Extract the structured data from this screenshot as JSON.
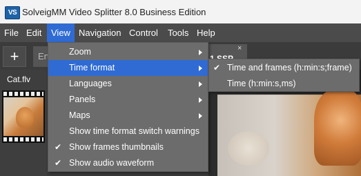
{
  "window": {
    "title": "SolveigMM Video Splitter 8.0 Business Edition",
    "icon_text": "VS"
  },
  "menubar": [
    "File",
    "Edit",
    "View",
    "Navigation",
    "Control",
    "Tools",
    "Help"
  ],
  "toolbar": {
    "add_label": "+",
    "tab_stub": "En",
    "tab_label": "1 SSP",
    "tab_close": "×"
  },
  "file_panel": {
    "file_name": "Cat.flv"
  },
  "view_menu": {
    "items": [
      {
        "label": "Zoom",
        "submenu": true,
        "checked": false
      },
      {
        "label": "Time format",
        "submenu": true,
        "checked": false,
        "highlighted": true
      },
      {
        "label": "Languages",
        "submenu": true,
        "checked": false
      },
      {
        "label": "Panels",
        "submenu": true,
        "checked": false
      },
      {
        "label": "Maps",
        "submenu": true,
        "checked": false
      },
      {
        "label": "Show time format switch warnings",
        "submenu": false,
        "checked": false
      },
      {
        "label": "Show frames thumbnails",
        "submenu": false,
        "checked": true
      },
      {
        "label": "Show audio waveform",
        "submenu": false,
        "checked": true
      }
    ],
    "check_glyph": "✔"
  },
  "time_format_menu": {
    "items": [
      {
        "label": "Time and frames (h:min:s;frame)",
        "checked": true
      },
      {
        "label": "Time (h:min:s,ms)",
        "checked": false
      }
    ]
  }
}
